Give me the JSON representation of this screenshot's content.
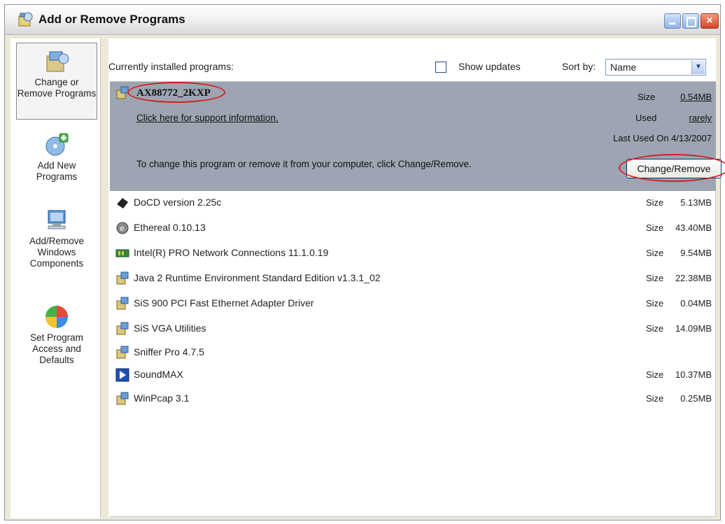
{
  "window": {
    "title": "Add or Remove Programs",
    "controls": {
      "close": "×"
    }
  },
  "sidebar": {
    "items": [
      {
        "label": "Change or Remove Programs",
        "icon": "change-remove-icon",
        "active": true
      },
      {
        "label": "Add New Programs",
        "icon": "add-programs-icon",
        "active": false
      },
      {
        "label": "Add/Remove Windows Components",
        "icon": "windows-components-icon",
        "active": false
      },
      {
        "label": "Set Program Access and Defaults",
        "icon": "program-access-icon",
        "active": false
      }
    ]
  },
  "toolbar": {
    "currently_installed_label": "Currently installed programs:",
    "show_updates_label": "Show updates",
    "show_updates_checked": false,
    "sort_by_label": "Sort by:",
    "sort_value": "Name"
  },
  "selected_program": {
    "name": "AX88772_2KXP",
    "support_link": "Click here for support information.",
    "size_label": "Size",
    "size_value": "0.54MB",
    "used_label": "Used",
    "used_value": "rarely",
    "last_used": "Last Used On 4/13/2007",
    "change_text": "To change this program or remove it from your computer, click Change/Remove.",
    "change_button": "Change/Remove"
  },
  "programs": [
    {
      "name": "DoCD version 2.25c",
      "size_label": "Size",
      "size": "5.13MB",
      "icon": "docd-icon"
    },
    {
      "name": "Ethereal 0.10.13",
      "size_label": "Size",
      "size": "43.40MB",
      "icon": "ethereal-icon"
    },
    {
      "name": "Intel(R) PRO Network Connections 11.1.0.19",
      "size_label": "Size",
      "size": "9.54MB",
      "icon": "network-card-icon"
    },
    {
      "name": "Java 2 Runtime Environment Standard Edition v1.3.1_02",
      "size_label": "Size",
      "size": "22.38MB",
      "icon": "installer-icon"
    },
    {
      "name": "SiS 900 PCI Fast Ethernet Adapter Driver",
      "size_label": "Size",
      "size": "0.04MB",
      "icon": "installer-icon"
    },
    {
      "name": "SiS VGA Utilities",
      "size_label": "Size",
      "size": "14.09MB",
      "icon": "installer-icon"
    },
    {
      "name": "Sniffer Pro 4.7.5",
      "size_label": "",
      "size": "",
      "icon": "installer-icon"
    },
    {
      "name": "SoundMAX",
      "size_label": "Size",
      "size": "10.37MB",
      "icon": "soundmax-icon"
    },
    {
      "name": "WinPcap 3.1",
      "size_label": "Size",
      "size": "0.25MB",
      "icon": "installer-icon"
    }
  ],
  "colors": {
    "selection": "#9da4b2",
    "annotation": "#d42020",
    "window_frame": "#ece9d8"
  }
}
